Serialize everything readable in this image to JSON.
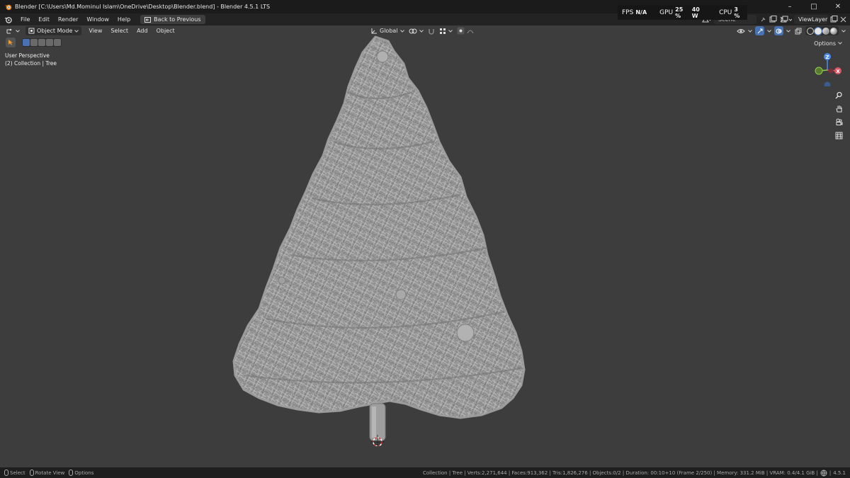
{
  "window": {
    "title": "Blender [C:\\Users\\Md.Mominul Islam\\OneDrive\\Desktop\\Blender.blend] - Blender 4.5.1 LTS",
    "minimize": "–",
    "maximize": "□",
    "close": "✕"
  },
  "perf": {
    "fps_label": "FPS",
    "fps_value": "N/A",
    "gpu_label": "GPU",
    "gpu_value": "25 %",
    "gpu_power": "40 W",
    "cpu_label": "CPU",
    "cpu_value": "3 %"
  },
  "menubar": {
    "items": [
      "File",
      "Edit",
      "Render",
      "Window",
      "Help"
    ],
    "back_button": "Back to Previous",
    "scene": "Scene",
    "view_layer": "ViewLayer"
  },
  "viewport_header": {
    "mode": "Object Mode",
    "menus": [
      "View",
      "Select",
      "Add",
      "Object"
    ],
    "orientation": "Global",
    "options": "Options"
  },
  "viewport_info": {
    "perspective": "User Perspective",
    "collection": "(2) Collection | Tree"
  },
  "gizmo": {
    "z": "Z",
    "x": "X"
  },
  "statusbar": {
    "select": "Select",
    "rotate": "Rotate View",
    "options": "Options",
    "stats": "Collection | Tree | Verts:2,271,644 | Faces:913,362 | Tris:1,826,276 | Objects:0/2 | Duration: 00:10+10 (Frame 2/250) | Memory: 331.2 MiB | VRAM: 0.4/4.1 GiB |",
    "version": "4.5.1"
  },
  "colors": {
    "viewport_bg": "#3d3d3d",
    "accent_blue": "#4772b3",
    "axis_x": "#e05563",
    "axis_y": "#8bd24a",
    "axis_z": "#4c8cf0",
    "tree": "#a8a8a8"
  }
}
